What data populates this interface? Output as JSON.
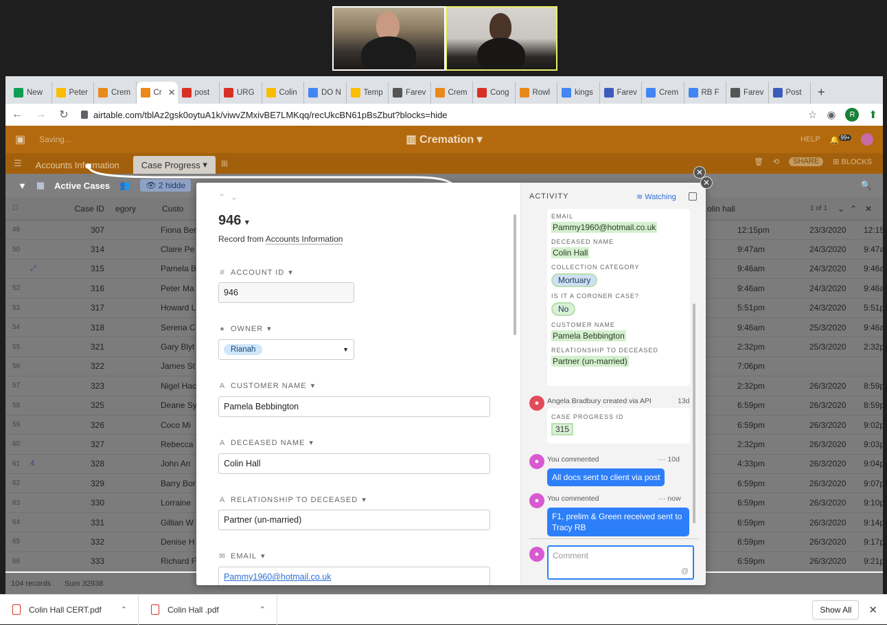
{
  "browser": {
    "tabs": [
      {
        "label": "New",
        "color": "#0f9d58"
      },
      {
        "label": "Peter",
        "color": "#fbbc04"
      },
      {
        "label": "Crem",
        "color": "#e8891a"
      },
      {
        "label": "Cr",
        "color": "#e8891a",
        "active": true
      },
      {
        "label": "post",
        "color": "#d93025"
      },
      {
        "label": "URG",
        "color": "#d93025"
      },
      {
        "label": "Colin",
        "color": "#fbbc04"
      },
      {
        "label": "DO N",
        "color": "#4285f4"
      },
      {
        "label": "Temp",
        "color": "#fbbc04"
      },
      {
        "label": "Farev",
        "color": "#555555"
      },
      {
        "label": "Crem",
        "color": "#e8891a"
      },
      {
        "label": "Cong",
        "color": "#d93025"
      },
      {
        "label": "Rowl",
        "color": "#e8891a"
      },
      {
        "label": "kings",
        "color": "#4285f4"
      },
      {
        "label": "Farev",
        "color": "#3b5bbd"
      },
      {
        "label": "Crem",
        "color": "#4285f4"
      },
      {
        "label": "RB F",
        "color": "#4285f4"
      },
      {
        "label": "Farev",
        "color": "#555555"
      },
      {
        "label": "Post",
        "color": "#3b5bbd"
      }
    ],
    "url": "airtable.com/tblAz2gsk0oytuA1k/viwvZMxivBE7LMKqq/recUkcBN61pBsZbut?blocks=hide",
    "profile_initial": "R"
  },
  "app": {
    "saving_text": "Saving...",
    "base_title": "Cremation",
    "help": "HELP",
    "notifications": "99+",
    "tables": [
      "Accounts Information",
      "Case Progress"
    ],
    "share": "SHARE",
    "blocks": "BLOCKS",
    "view_name": "Active Cases",
    "hidden_fields": "2 hidde",
    "columns": {
      "case_id": "Case ID",
      "category": "egory",
      "customer": "Custo",
      "colin_hall": "olin hall"
    },
    "record_counter": "1 of 1",
    "rows": [
      {
        "num": "49",
        "id": "307",
        "cust": "Fiona Ber",
        "time": "12:15pm",
        "date": "23/3/2020",
        "extra": "12:15"
      },
      {
        "num": "50",
        "id": "314",
        "cust": "Claire Pe",
        "time": "9:47am",
        "date": "24/3/2020",
        "extra": "9:47a"
      },
      {
        "num": "",
        "id": "315",
        "cust": "Pamela B",
        "time": "9:46am",
        "date": "24/3/2020",
        "extra": "9:46a",
        "exp": "⤢"
      },
      {
        "num": "52",
        "id": "316",
        "cust": "Peter Ma",
        "time": "9:46am",
        "date": "24/3/2020",
        "extra": "9:46a"
      },
      {
        "num": "53",
        "id": "317",
        "cust": "Howard L",
        "time": "5:51pm",
        "date": "24/3/2020",
        "extra": "5:51p"
      },
      {
        "num": "54",
        "id": "318",
        "cust": "Serena C",
        "time": "9:46am",
        "date": "25/3/2020",
        "extra": "9:46a"
      },
      {
        "num": "55",
        "id": "321",
        "cust": "Gary Blyt",
        "time": "2:32pm",
        "date": "25/3/2020",
        "extra": "2:32p"
      },
      {
        "num": "56",
        "id": "322",
        "cust": "James St",
        "time": "7:06pm",
        "date": "",
        "extra": ""
      },
      {
        "num": "57",
        "id": "323",
        "cust": "Nigel Hac",
        "time": "2:32pm",
        "date": "26/3/2020",
        "extra": "8:59p"
      },
      {
        "num": "58",
        "id": "325",
        "cust": "Deane Sy",
        "time": "6:59pm",
        "date": "26/3/2020",
        "extra": "8:59p"
      },
      {
        "num": "59",
        "id": "326",
        "cust": "Coco Mi",
        "time": "6:59pm",
        "date": "26/3/2020",
        "extra": "9:02p"
      },
      {
        "num": "60",
        "id": "327",
        "cust": "Rebecca",
        "time": "2:32pm",
        "date": "26/3/2020",
        "extra": "9:03p"
      },
      {
        "num": "61",
        "id": "328",
        "cust": "John An",
        "time": "4:33pm",
        "date": "26/3/2020",
        "extra": "9:04p",
        "exp": "4"
      },
      {
        "num": "62",
        "id": "329",
        "cust": "Barry Bor",
        "time": "6:59pm",
        "date": "26/3/2020",
        "extra": "9:07p"
      },
      {
        "num": "63",
        "id": "330",
        "cust": "Lorraine",
        "time": "6:59pm",
        "date": "26/3/2020",
        "extra": "9:10p"
      },
      {
        "num": "64",
        "id": "331",
        "cust": "Gillian W",
        "time": "6:59pm",
        "date": "26/3/2020",
        "extra": "9:14p"
      },
      {
        "num": "65",
        "id": "332",
        "cust": "Denise H",
        "time": "6:59pm",
        "date": "26/3/2020",
        "extra": "9:17p"
      },
      {
        "num": "66",
        "id": "333",
        "cust": "Richard F",
        "time": "6:59pm",
        "date": "26/3/2020",
        "extra": "9:21p"
      }
    ],
    "footer": {
      "records": "104 records",
      "sum": "Sum 32938"
    }
  },
  "record": {
    "id_title": "946",
    "from_prefix": "Record from",
    "from_table": "Accounts Information",
    "fields": {
      "account_id": {
        "label": "ACCOUNT ID",
        "value": "946"
      },
      "owner": {
        "label": "OWNER",
        "value": "Rianah"
      },
      "customer_name": {
        "label": "CUSTOMER NAME",
        "value": "Pamela Bebbington"
      },
      "deceased_name": {
        "label": "DECEASED NAME",
        "value": "Colin Hall"
      },
      "relationship": {
        "label": "RELATIONSHIP TO DECEASED",
        "value": "Partner (un-married)"
      },
      "email": {
        "label": "EMAIL",
        "value": "Pammy1960@hotmail.co.uk"
      }
    }
  },
  "activity": {
    "heading": "ACTIVITY",
    "watching": "Watching",
    "card1": {
      "email_label": "EMAIL",
      "email": "Pammy1960@hotmail.co.uk",
      "deceased_label": "DECEASED NAME",
      "deceased": "Colin Hall",
      "collection_label": "COLLECTION CATEGORY",
      "collection": "Mortuary",
      "coroner_label": "IS IT A CORONER CASE?",
      "coroner": "No",
      "customer_label": "CUSTOMER NAME",
      "customer": "Pamela Bebbington",
      "relationship_label": "RELATIONSHIP TO DECEASED",
      "relationship": "Partner (un-married)"
    },
    "created": {
      "meta": "Angela Bradbury created via API",
      "time": "13d",
      "label": "CASE PROGRESS ID",
      "value": "315"
    },
    "comments": [
      {
        "meta": "You commented",
        "time": "10d",
        "text": "All docs sent to client via post"
      },
      {
        "meta": "You commented",
        "time": "now",
        "text": "F1, prelim & Green received sent to Tracy RB"
      }
    ],
    "comment_placeholder": "Comment"
  },
  "downloads": {
    "files": [
      "Colin Hall CERT.pdf",
      "Colin Hall .pdf"
    ],
    "show_all": "Show All"
  }
}
